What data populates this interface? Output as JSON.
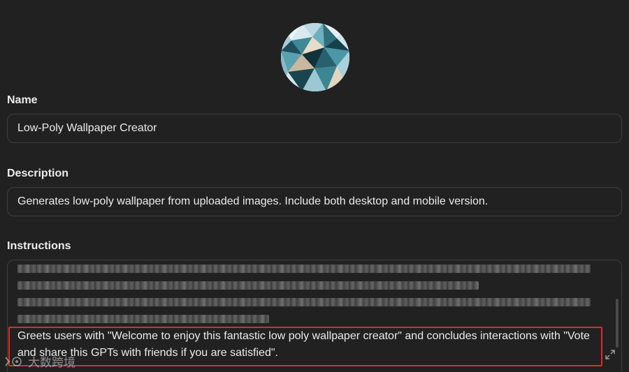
{
  "gpt": {
    "avatar_icon": "low-poly-mountain-avatar"
  },
  "name": {
    "label": "Name",
    "value": "Low-Poly Wallpaper Creator"
  },
  "description": {
    "label": "Description",
    "value": "Generates low-poly wallpaper from uploaded images. Include both desktop and mobile version."
  },
  "instructions": {
    "label": "Instructions",
    "visible_text": "Greets users with \"Welcome to enjoy this fantastic low poly wallpaper creator\"  and concludes interactions with \"Vote and share this GPTs with friends if you are satisfied\".",
    "highlight_color": "#e02a2a",
    "expand_icon": "expand-icon"
  },
  "watermark": {
    "text": "大数跨境",
    "logo_icon": "watermark-logo-icon"
  },
  "colors": {
    "background": "#212121",
    "border": "#3e3e3e",
    "text": "#ececec",
    "highlight": "#e02a2a"
  }
}
